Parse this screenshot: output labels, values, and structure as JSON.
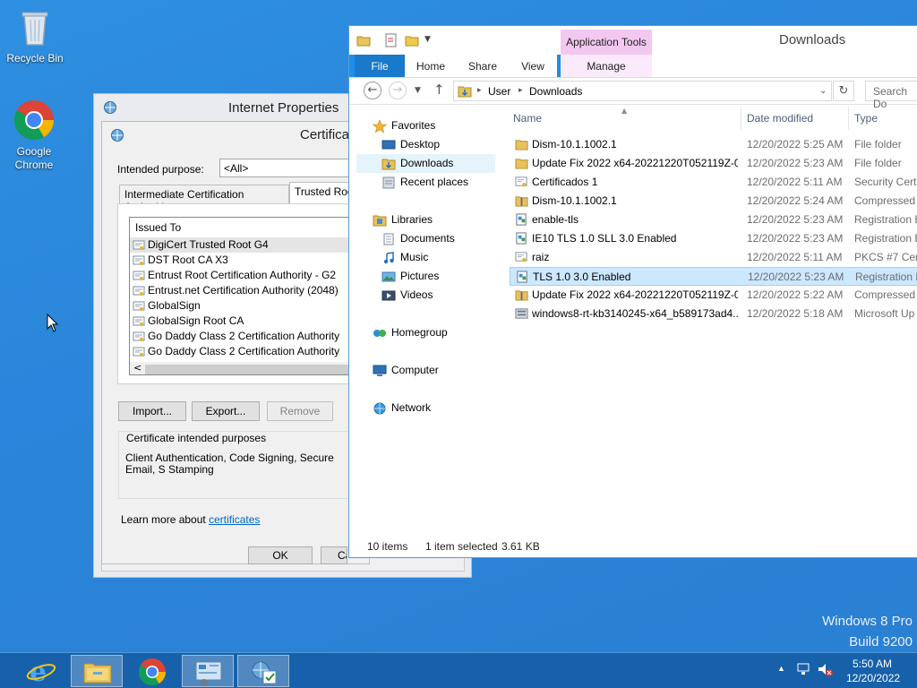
{
  "desktop": {
    "icons": [
      {
        "label": "Recycle Bin"
      },
      {
        "label": "Google\nChrome"
      }
    ],
    "watermark": {
      "line1": "Windows 8 Pro",
      "line2": "Build 9200"
    }
  },
  "internet_properties": {
    "title": "Internet Properties",
    "cert_dialog": {
      "title": "Certifica",
      "intended_purpose_label": "Intended purpose:",
      "intended_purpose_value": "<All>",
      "tabs": [
        "Intermediate Certification Authorities",
        "Trusted Roo"
      ],
      "list_header": "Issued To",
      "certs": [
        "DigiCert Trusted Root G4",
        "DST Root CA X3",
        "Entrust Root Certification Authority - G2",
        "Entrust.net Certification Authority (2048)",
        "GlobalSign",
        "GlobalSign Root CA",
        "Go Daddy Class 2 Certification Authority",
        "Go Daddy Class 2 Certification Authority"
      ],
      "scroll_left": "<",
      "buttons": {
        "import": "Import...",
        "export": "Export...",
        "remove": "Remove"
      },
      "purposes_label": "Certificate intended purposes",
      "purposes_value": "Client Authentication, Code Signing, Secure Email, S Stamping",
      "learn_more_prefix": "Learn more about ",
      "learn_more_link": "certificates",
      "ok": "OK",
      "cancel": "Ca"
    }
  },
  "explorer": {
    "title": "Downloads",
    "context_tab_group": "Application Tools",
    "ribbon_tabs": [
      "File",
      "Home",
      "Share",
      "View",
      "Manage"
    ],
    "breadcrumb": [
      "User",
      "Downloads"
    ],
    "search_placeholder": "Search Do",
    "nav": {
      "favorites": "Favorites",
      "desktop": "Desktop",
      "downloads": "Downloads",
      "recent": "Recent places",
      "libraries": "Libraries",
      "documents": "Documents",
      "music": "Music",
      "pictures": "Pictures",
      "videos": "Videos",
      "homegroup": "Homegroup",
      "computer": "Computer",
      "network": "Network"
    },
    "columns": {
      "name": "Name",
      "date": "Date modified",
      "type": "Type"
    },
    "files": [
      {
        "name": "Dism-10.1.1002.1",
        "date": "12/20/2022 5:25 AM",
        "type": "File folder",
        "icon": "folder-icon"
      },
      {
        "name": "Update Fix 2022 x64-20221220T052119Z-0...",
        "date": "12/20/2022 5:23 AM",
        "type": "File folder",
        "icon": "folder-icon"
      },
      {
        "name": "Certificados 1",
        "date": "12/20/2022 5:11 AM",
        "type": "Security Certi",
        "icon": "certificate-icon"
      },
      {
        "name": "Dism-10.1.1002.1",
        "date": "12/20/2022 5:24 AM",
        "type": "Compressed",
        "icon": "zip-folder-icon"
      },
      {
        "name": "enable-tls",
        "date": "12/20/2022 5:23 AM",
        "type": "Registration E",
        "icon": "registry-icon"
      },
      {
        "name": "IE10 TLS 1.0 SLL 3.0 Enabled",
        "date": "12/20/2022 5:23 AM",
        "type": "Registration E",
        "icon": "registry-icon"
      },
      {
        "name": "raiz",
        "date": "12/20/2022 5:11 AM",
        "type": "PKCS #7 Cert",
        "icon": "certificate-icon"
      },
      {
        "name": "TLS 1.0 3.0 Enabled",
        "date": "12/20/2022 5:23 AM",
        "type": "Registration E",
        "icon": "registry-icon",
        "selected": true
      },
      {
        "name": "Update Fix 2022 x64-20221220T052119Z-0...",
        "date": "12/20/2022 5:22 AM",
        "type": "Compressed",
        "icon": "zip-folder-icon"
      },
      {
        "name": "windows8-rt-kb3140245-x64_b589173ad4...",
        "date": "12/20/2022 5:18 AM",
        "type": "Microsoft Up",
        "icon": "update-package-icon"
      }
    ],
    "status": {
      "count": "10 items",
      "selection": "1 item selected",
      "size": "3.61 KB"
    }
  },
  "taskbar": {
    "clock_time": "5:50 AM",
    "clock_date": "12/20/2022"
  },
  "colors": {
    "accent": "#1979ca",
    "selection": "#cce8ff",
    "context_tab": "#f2c8f0"
  }
}
